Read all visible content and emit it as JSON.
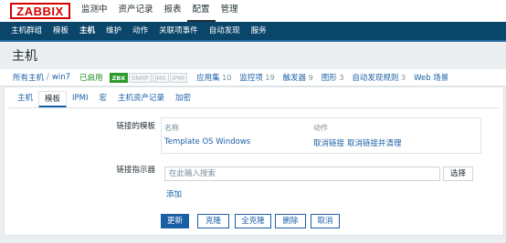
{
  "logo": "ZABBIX",
  "top_nav": [
    {
      "label": "监测中"
    },
    {
      "label": "资产记录"
    },
    {
      "label": "报表"
    },
    {
      "label": "配置"
    },
    {
      "label": "管理"
    }
  ],
  "top_nav_active": 3,
  "sub_nav": [
    {
      "label": "主机群组"
    },
    {
      "label": "模板"
    },
    {
      "label": "主机"
    },
    {
      "label": "维护"
    },
    {
      "label": "动作"
    },
    {
      "label": "关联项事件"
    },
    {
      "label": "自动发现"
    },
    {
      "label": "服务"
    }
  ],
  "sub_nav_active": 2,
  "page_title": "主机",
  "breadcrumb": {
    "all_hosts": "所有主机",
    "separator": "/",
    "host": "win7",
    "status": "已启用",
    "badges": [
      "ZBX",
      "SNMP",
      "JMX",
      "IPMI"
    ],
    "links": [
      {
        "label": "应用集",
        "count": "10"
      },
      {
        "label": "监控项",
        "count": "19"
      },
      {
        "label": "触发器",
        "count": "9"
      },
      {
        "label": "图形",
        "count": "3"
      },
      {
        "label": "自动发现规则",
        "count": "3"
      },
      {
        "label": "Web 场景",
        "count": ""
      }
    ]
  },
  "tabs": [
    {
      "label": "主机"
    },
    {
      "label": "模板"
    },
    {
      "label": "IPMI"
    },
    {
      "label": "宏"
    },
    {
      "label": "主机资产记录"
    },
    {
      "label": "加密"
    }
  ],
  "tab_active": 1,
  "linked_templates": {
    "label": "链接的模板",
    "col_name": "名称",
    "col_action": "动作",
    "rows": [
      {
        "name": "Template OS Windows",
        "unlink": "取消链接",
        "unlink_clear": "取消链接并清理"
      }
    ]
  },
  "link_indicator": {
    "label": "链接指示器",
    "placeholder": "在此输入搜索",
    "select_label": "选择",
    "add_label": "添加"
  },
  "buttons": {
    "update": "更新",
    "clone": "克隆",
    "full_clone": "全克隆",
    "delete": "删除",
    "cancel": "取消"
  }
}
